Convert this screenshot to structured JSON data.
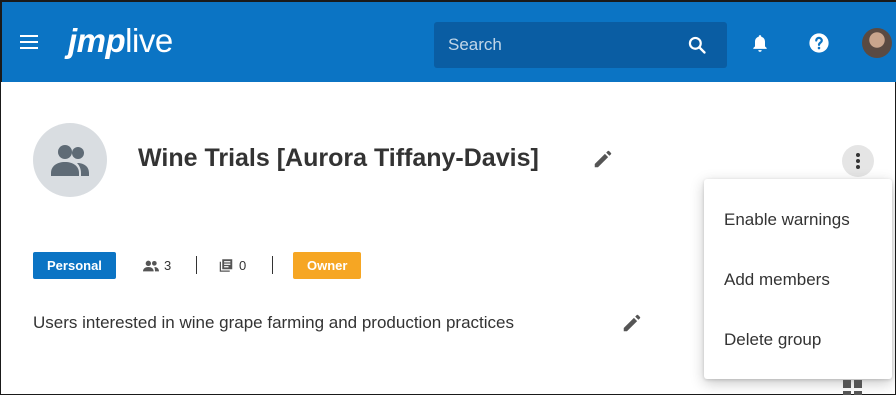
{
  "header": {
    "logo_jmp": "jmp",
    "logo_live": "live",
    "search_placeholder": "Search",
    "icons": [
      "menu-icon",
      "search-icon",
      "bell-icon",
      "help-icon",
      "user-avatar"
    ],
    "colors": {
      "brand": "#0b74c4",
      "search_bg": "#0a5da3"
    }
  },
  "group": {
    "title": "Wine Trials [Aurora Tiffany-Davis]",
    "badge_personal": "Personal",
    "members_count": "3",
    "posts_count": "0",
    "badge_owner": "Owner",
    "description": "Users interested in wine grape farming and production practices",
    "colors": {
      "personal": "#0b74c4",
      "owner": "#f6a623"
    }
  },
  "menu": {
    "items": [
      {
        "label": "Enable warnings"
      },
      {
        "label": "Add members"
      },
      {
        "label": "Delete group"
      }
    ]
  }
}
